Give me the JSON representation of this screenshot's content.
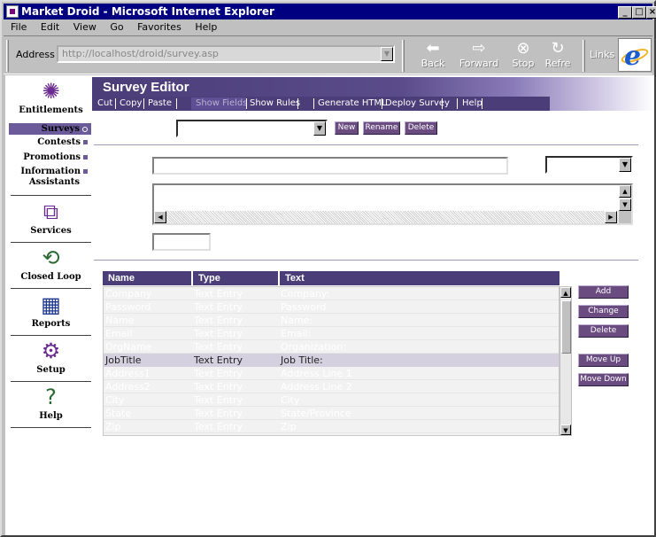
{
  "window": {
    "title": "Market Droid - Microsoft Internet Explorer"
  },
  "menu": [
    "File",
    "Edit",
    "View",
    "Go",
    "Favorites",
    "Help"
  ],
  "toolbar": {
    "address_label": "Address",
    "address_value": "http://localhost/droid/survey.asp",
    "back": "Back",
    "forward": "Forward",
    "stop": "Stop",
    "refresh": "Refre",
    "links": "Links"
  },
  "nav": {
    "items": [
      {
        "label": "Entitlements",
        "icon": "entitlements-icon"
      },
      {
        "label": "Services",
        "icon": "services-icon"
      },
      {
        "label": "Closed Loop",
        "icon": "closed-loop-icon"
      },
      {
        "label": "Reports",
        "icon": "reports-icon"
      },
      {
        "label": "Setup",
        "icon": "setup-icon"
      },
      {
        "label": "Help",
        "icon": "help-icon"
      }
    ],
    "sub": [
      "Surveys",
      "Contests",
      "Promotions",
      "Information",
      "Assistants"
    ]
  },
  "editor": {
    "title": "Survey Editor",
    "commands": [
      "Cut",
      "Copy",
      "Paste",
      "Show Fields",
      "Show Rules",
      "Generate HTML",
      "Deploy Survey",
      "Help"
    ]
  },
  "buttons": {
    "new": "New",
    "rename": "Rename",
    "delete": "Delete",
    "add": "Add",
    "change": "Change",
    "delete2": "Delete",
    "move_up": "Move Up",
    "move_down": "Move Down"
  },
  "grid": {
    "columns": [
      "Name",
      "Type",
      "Text"
    ],
    "rows": [
      [
        "Company",
        "Text Entry",
        "Company:"
      ],
      [
        "Password",
        "Text Entry",
        "Password"
      ],
      [
        "Name",
        "Text Entry",
        "Name:"
      ],
      [
        "Email",
        "Text Entry",
        "Email:"
      ],
      [
        "OrgName",
        "Text Entry",
        "Organization:"
      ],
      [
        "JobTitle",
        "Text Entry",
        "Job Title:"
      ],
      [
        "Address1",
        "Text Entry",
        "Address Line 1"
      ],
      [
        "Address2",
        "Text Entry",
        "Address Line 2"
      ],
      [
        "City",
        "Text Entry",
        "City"
      ],
      [
        "State",
        "Text Entry",
        "State/Province"
      ],
      [
        "Zip",
        "Text Entry",
        "Zip"
      ]
    ],
    "selected_row": 5
  },
  "colors": {
    "accent": "#4a3d78",
    "button": "#6a4c80",
    "titlebar": "#000080"
  }
}
